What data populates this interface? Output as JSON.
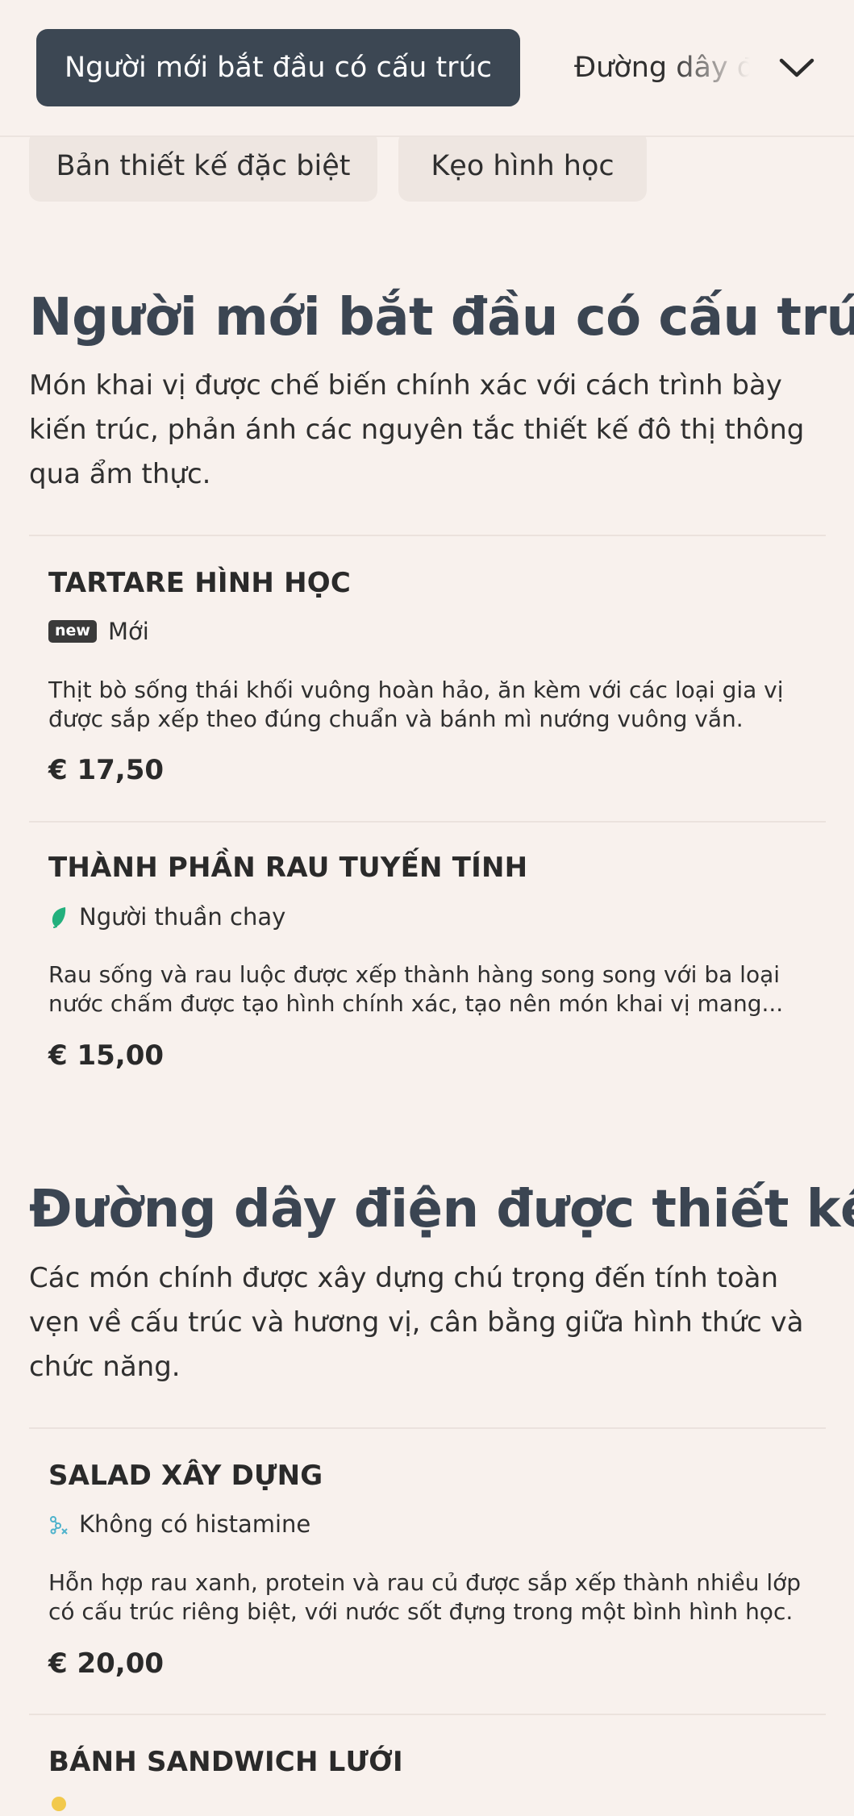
{
  "nav": {
    "active_tab": "Người mới bắt đầu có cấu trúc",
    "next_tab": "Đường dây điện được thiết kế",
    "chevron_icon": "chevron-down-icon"
  },
  "subtabs": [
    {
      "label": "Bản thiết kế đặc biệt"
    },
    {
      "label": "Kẹo hình học"
    }
  ],
  "sections": [
    {
      "title": "Người mới bắt đầu có cấu trúc",
      "description": "Món khai vị được chế biến chính xác với cách trình bày kiến trúc, phản ánh các nguyên tắc thiết kế đô thị thông qua ẩm thực.",
      "items": [
        {
          "name": "TARTARE HÌNH HỌC",
          "badge": "new",
          "tag": "Mới",
          "description": "Thịt bò sống thái khối vuông hoàn hảo, ăn kèm với các loại gia vị được sắp xếp theo đúng chuẩn và bánh mì nướng vuông vắn.",
          "price": "€ 17,50"
        },
        {
          "name": "THÀNH PHẦN RAU TUYẾN TÍNH",
          "tag_icon": "leaf-icon",
          "tag": "Người thuần chay",
          "description": "Rau sống và rau luộc được xếp thành hàng song song với ba loại nước chấm được tạo hình chính xác, tạo nên món khai vị mang...",
          "price": "€ 15,00"
        }
      ]
    },
    {
      "title": "Đường dây điện được thiết kế",
      "description": "Các món chính được xây dựng chú trọng đến tính toàn vẹn về cấu trúc và hương vị, cân bằng giữa hình thức và chức năng.",
      "items": [
        {
          "name": "SALAD XÂY DỰNG",
          "tag_icon": "histamine-free-icon",
          "tag": "Không có histamine",
          "description": "Hỗn hợp rau xanh, protein và rau củ được sắp xếp thành nhiều lớp có cấu trúc riêng biệt, với nước sốt đựng trong một bình hình học.",
          "price": "€ 20,00"
        },
        {
          "name": "BÁNH SANDWICH LƯỚI"
        }
      ]
    }
  ],
  "colors": {
    "background": "#f8f1ed",
    "active_tab": "#3c4753",
    "subtab": "#eee6e1",
    "heading": "#3b4552",
    "vegan_green": "#23b07d",
    "histamine_teal": "#4fb3cc"
  }
}
